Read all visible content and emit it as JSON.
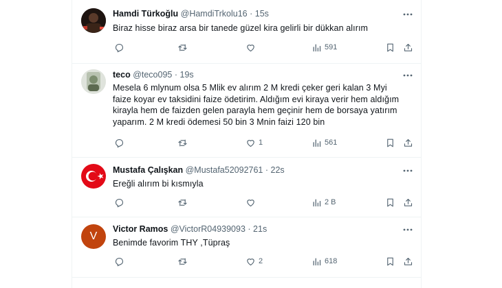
{
  "tweets": [
    {
      "name": "Hamdi Türkoğlu",
      "handle": "@HamdiTrkolu16",
      "sep": "·",
      "time": "15s",
      "text": "Biraz hisse biraz arsa bir tanede güzel kira gelirli bir dükkan alırım",
      "likes": "",
      "views": "591",
      "avatar": "photo"
    },
    {
      "name": "teco",
      "handle": "@teco095",
      "sep": "·",
      "time": "19s",
      "text": "Mesela 6 mlynum olsa 5 Mlik  ev alırım 2 M kredi çeker geri kalan 3 Myi faize koyar ev taksidini faize ödetirim. Aldığım evi kiraya verir hem aldığım kirayla hem de faizden gelen parayla hem geçinir hem de borsaya yatırım yaparım. 2 M kredi ödemesi 50 bin 3 Mnin faizi 120 bin",
      "likes": "1",
      "views": "561",
      "avatar": "photo"
    },
    {
      "name": "Mustafa Çalışkan",
      "handle": "@Mustafa52092761",
      "sep": "·",
      "time": "22s",
      "text": "Ereğli alırım bi kısmıyla",
      "likes": "",
      "views": "2 B",
      "avatar": "turkish-flag"
    },
    {
      "name": "Victor Ramos",
      "handle": "@VictorR04939093",
      "sep": "·",
      "time": "21s",
      "text": "Benimde favorim THY ,Tüpraş",
      "likes": "2",
      "views": "618",
      "avatar": "letter",
      "avatar_letter": "V"
    }
  ],
  "colors": {
    "text": "#0f1419",
    "secondary": "#536471",
    "border": "#eff3f4",
    "avatar_letter_bg": "#c1440e",
    "flag_red": "#e30a17"
  },
  "icons": [
    "reply-icon",
    "retweet-icon",
    "like-icon",
    "views-icon",
    "bookmark-icon",
    "share-icon",
    "more-icon"
  ]
}
